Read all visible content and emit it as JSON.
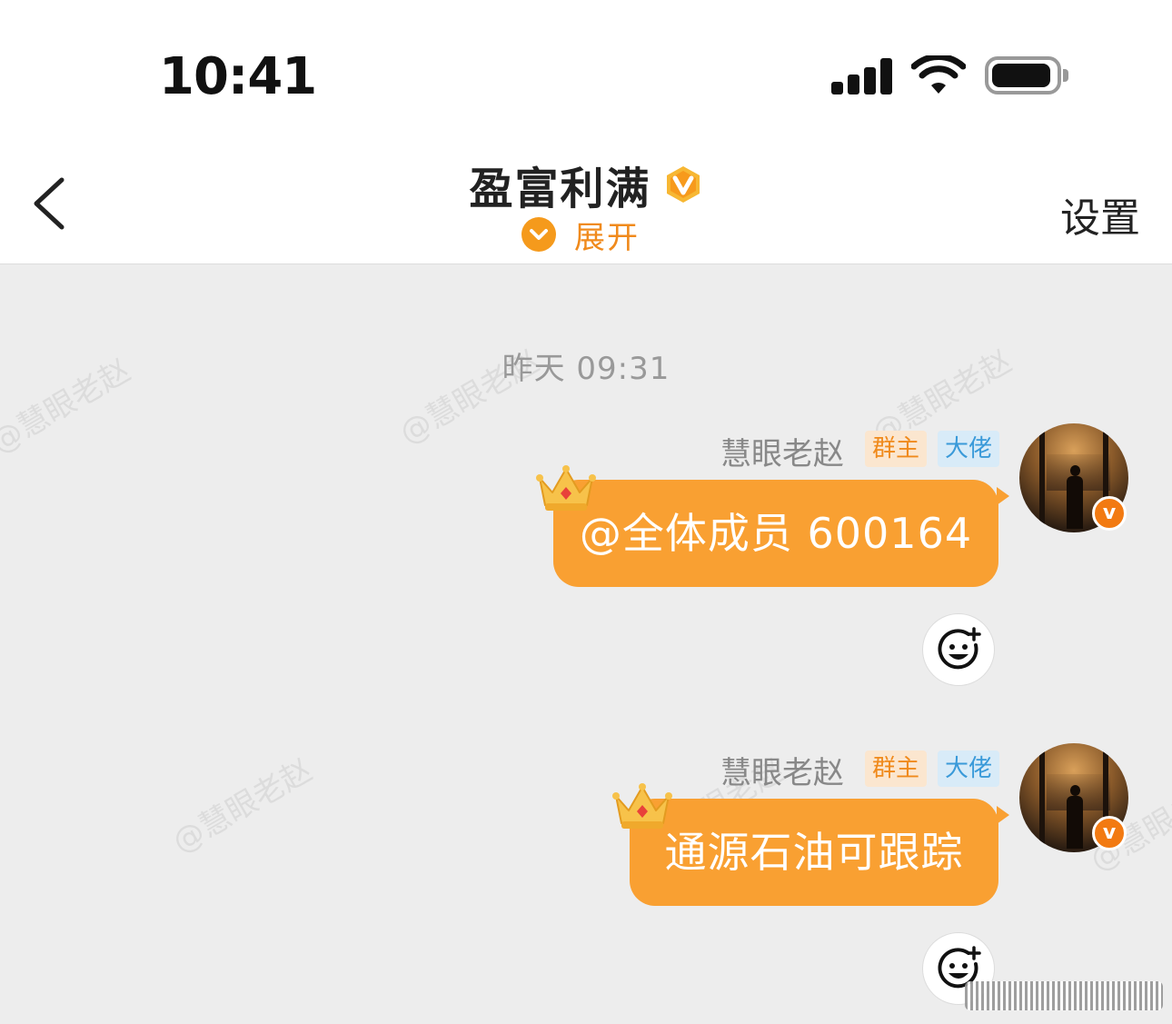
{
  "status_bar": {
    "time": "10:41",
    "signal_icon": "cellular-signal-icon",
    "wifi_icon": "wifi-icon",
    "battery_icon": "battery-icon"
  },
  "header": {
    "back_icon": "chevron-left-icon",
    "title": "盈富利满",
    "verified_icon": "verified-v-badge-icon",
    "expand_label": "展开",
    "expand_icon": "chevron-down-circle-icon",
    "settings_label": "设置"
  },
  "chat": {
    "timestamp": "昨天 09:31",
    "watermark": "@慧眼老赵",
    "messages": [
      {
        "sender": "慧眼老赵",
        "tags": [
          "群主",
          "大佬"
        ],
        "text": "@全体成员 600164",
        "avatar_badge": "v",
        "crown_icon": "crown-icon",
        "react_icon": "add-reaction-icon"
      },
      {
        "sender": "慧眼老赵",
        "tags": [
          "群主",
          "大佬"
        ],
        "text": "通源石油可跟踪",
        "avatar_badge": "v",
        "crown_icon": "crown-icon",
        "react_icon": "add-reaction-icon"
      }
    ]
  },
  "colors": {
    "bubble": "#f9a032",
    "accent": "#f08a1c",
    "background": "#ededed",
    "owner_tag_bg": "#fbe6cf",
    "boss_tag_text": "#3a9ad9"
  }
}
